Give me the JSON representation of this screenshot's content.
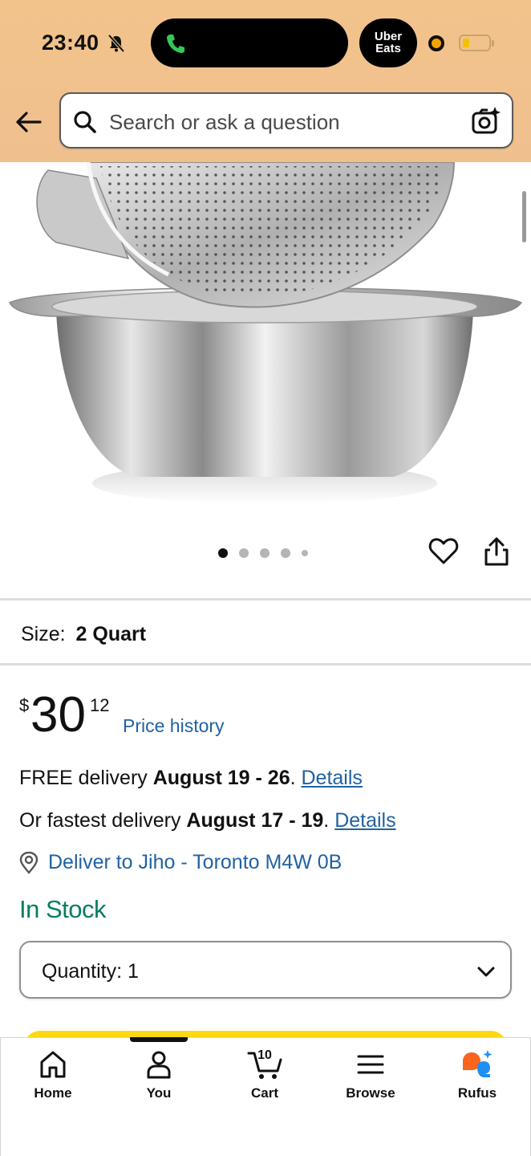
{
  "status_bar": {
    "time": "23:40",
    "uber_line1": "Uber",
    "uber_line2": "Eats"
  },
  "search": {
    "placeholder": "Search or ask a question"
  },
  "product": {
    "image_count": 5,
    "active_image": 1,
    "size_label": "Size:",
    "size_value": "2 Quart",
    "price_currency": "$",
    "price_whole": "30",
    "price_fraction": "12",
    "price_history_label": "Price history"
  },
  "delivery": {
    "free_prefix": "FREE delivery",
    "free_dates": "August 19 - 26",
    "free_suffix": ".",
    "free_link": "Details",
    "fast_prefix": "Or fastest delivery",
    "fast_dates": "August 17 - 19",
    "fast_suffix": ".",
    "fast_link": "Details",
    "deliver_to": "Deliver to Jiho - Toronto M4W 0B"
  },
  "stock_status": "In Stock",
  "quantity": {
    "label": "Quantity:",
    "value": "1"
  },
  "bottom_nav": {
    "items": [
      {
        "label": "Home",
        "icon": "home-icon"
      },
      {
        "label": "You",
        "icon": "person-icon"
      },
      {
        "label": "Cart",
        "icon": "cart-icon",
        "count": "10"
      },
      {
        "label": "Browse",
        "icon": "menu-icon"
      },
      {
        "label": "Rufus",
        "icon": "rufus-icon"
      }
    ]
  },
  "colors": {
    "header_bg": "#f0c38f",
    "link": "#2162a1",
    "in_stock": "#067d62",
    "buy_button": "#ffd814"
  }
}
